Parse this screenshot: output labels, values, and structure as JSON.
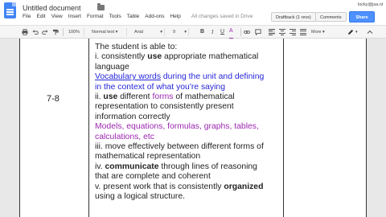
{
  "header": {
    "doc_title": "Untitled document",
    "user_email": "locky@jsa.nl",
    "menu": [
      "File",
      "Edit",
      "View",
      "Insert",
      "Format",
      "Tools",
      "Table",
      "Add-ons",
      "Help"
    ],
    "saved_status": "All changes saved in Drive",
    "draft_label": "Draftback (1 revs)",
    "comments_label": "Comments",
    "share_label": "Share"
  },
  "toolbar": {
    "zoom": "100%",
    "style": "Normal text",
    "font": "Arial",
    "font_size": "9",
    "bold": "B",
    "italic": "I",
    "underline": "U",
    "text_color": "A",
    "more": "More",
    "text_color_hex": "#9c27b0"
  },
  "document": {
    "level": "7-8",
    "lines": [
      {
        "parts": [
          {
            "t": "The student is able to:",
            "s": "n"
          }
        ]
      },
      {
        "parts": [
          {
            "t": "i.    consistently ",
            "s": "n"
          },
          {
            "t": "use",
            "s": "b"
          },
          {
            "t": " appropriate mathematical",
            "s": "n"
          }
        ]
      },
      {
        "parts": [
          {
            "t": "language",
            "s": "n"
          }
        ]
      },
      {
        "parts": [
          {
            "t": "Vocabulary words",
            "s": "bu"
          },
          {
            "t": " during the unit and defining",
            "s": "bl"
          }
        ]
      },
      {
        "parts": [
          {
            "t": "in the context of what you're saying",
            "s": "bl"
          }
        ]
      },
      {
        "parts": [
          {
            "t": "ii.   ",
            "s": "n"
          },
          {
            "t": "use",
            "s": "b"
          },
          {
            "t": " different ",
            "s": "n"
          },
          {
            "t": "forms",
            "s": "p"
          },
          {
            "t": " of mathematical",
            "s": "n"
          }
        ]
      },
      {
        "parts": [
          {
            "t": "representation to consistently present",
            "s": "n"
          }
        ]
      },
      {
        "parts": [
          {
            "t": "information correctly",
            "s": "n"
          }
        ]
      },
      {
        "parts": [
          {
            "t": "Models, equations, formulas, graphs, tables,",
            "s": "p"
          }
        ]
      },
      {
        "parts": [
          {
            "t": "calculations, etc",
            "s": "p"
          }
        ]
      },
      {
        "parts": [
          {
            "t": "iii.  move effectively between different forms of",
            "s": "n"
          }
        ]
      },
      {
        "parts": [
          {
            "t": "mathematical representation",
            "s": "n"
          }
        ]
      },
      {
        "parts": [
          {
            "t": "iv.  ",
            "s": "n"
          },
          {
            "t": "communicate",
            "s": "b"
          },
          {
            "t": " through lines of reasoning",
            "s": "n"
          }
        ]
      },
      {
        "parts": [
          {
            "t": "that are complete and coherent",
            "s": "n"
          }
        ]
      },
      {
        "parts": [
          {
            "t": "v.   present work that is consistently ",
            "s": "n"
          },
          {
            "t": "organized",
            "s": "b"
          }
        ]
      },
      {
        "parts": [
          {
            "t": "using a logical structure.",
            "s": "n"
          }
        ]
      }
    ]
  },
  "colors": {
    "accent_blue": "#4d90fe",
    "link_blue": "#2626d9",
    "purple": "#9c27b0"
  }
}
